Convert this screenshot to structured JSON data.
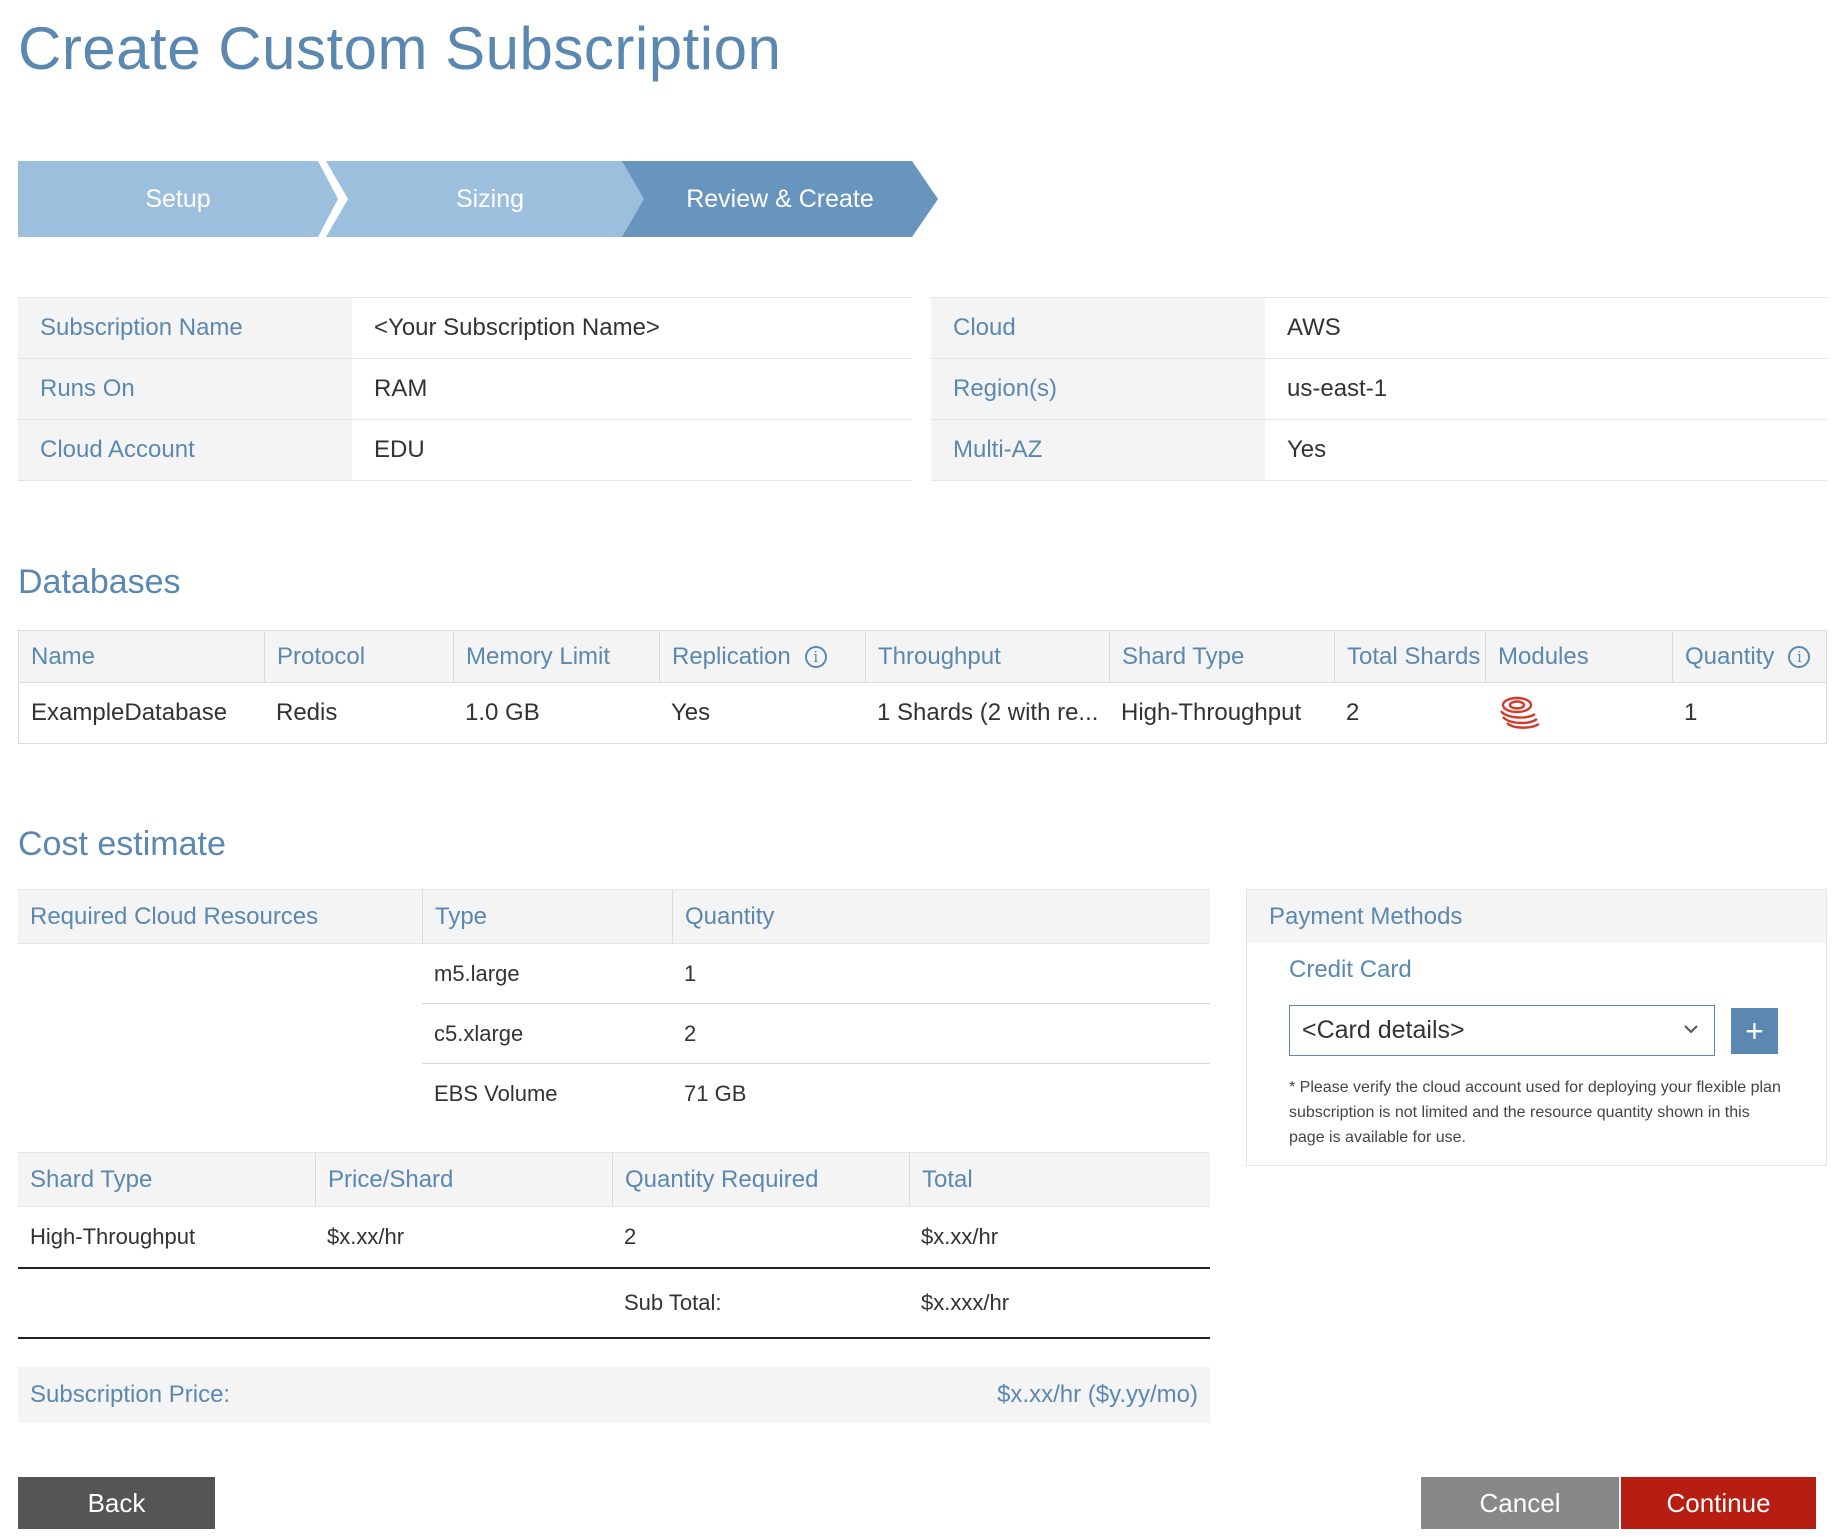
{
  "page": {
    "title": "Create Custom Subscription"
  },
  "wizard": {
    "steps": [
      "Setup",
      "Sizing",
      "Review & Create"
    ],
    "active_step": "Review & Create"
  },
  "summary_left": [
    {
      "label": "Subscription Name",
      "value": "<Your Subscription Name>"
    },
    {
      "label": "Runs On",
      "value": "RAM"
    },
    {
      "label": "Cloud Account",
      "value": "EDU"
    }
  ],
  "summary_right": [
    {
      "label": "Cloud",
      "value": "AWS"
    },
    {
      "label": "Region(s)",
      "value": "us-east-1"
    },
    {
      "label": "Multi-AZ",
      "value": "Yes"
    }
  ],
  "databases": {
    "heading": "Databases",
    "columns": [
      "Name",
      "Protocol",
      "Memory Limit",
      "Replication",
      "Throughput",
      "Shard Type",
      "Total Shards",
      "Modules",
      "Quantity"
    ],
    "rows": [
      {
        "name": "ExampleDatabase",
        "protocol": "Redis",
        "memory_limit": "1.0 GB",
        "replication": "Yes",
        "throughput": "1 Shards (2 with re...",
        "shard_type": "High-Throughput",
        "total_shards": "2",
        "modules": "module-stack-icon",
        "quantity": "1"
      }
    ]
  },
  "cost": {
    "heading": "Cost estimate",
    "resources": {
      "columns": [
        "Required Cloud Resources",
        "Type",
        "Quantity"
      ],
      "rows": [
        {
          "type": "m5.large",
          "quantity": "1"
        },
        {
          "type": "c5.xlarge",
          "quantity": "2"
        },
        {
          "type": "EBS Volume",
          "quantity": "71 GB"
        }
      ]
    },
    "shards": {
      "columns": [
        "Shard Type",
        "Price/Shard",
        "Quantity Required",
        "Total"
      ],
      "rows": [
        {
          "shard_type": "High-Throughput",
          "price": "$x.xx/hr",
          "quantity": "2",
          "total": "$x.xx/hr"
        }
      ],
      "subtotal_label": "Sub Total:",
      "subtotal_value": "$x.xxx/hr"
    },
    "subscription_price_label": "Subscription Price:",
    "subscription_price_value": "$x.xx/hr ($y.yy/mo)"
  },
  "payment": {
    "heading": "Payment Methods",
    "method_label": "Credit Card",
    "selected_card": "<Card details>",
    "add_label": "+",
    "note": "* Please verify the cloud account used for deploying your flexible plan subscription is not limited and the resource quantity shown in this page is available for use."
  },
  "buttons": {
    "back": "Back",
    "cancel": "Cancel",
    "continue": "Continue"
  },
  "colors": {
    "accent": "#5b88b0",
    "step_inactive": "#9dbfde",
    "step_active": "#6795bd",
    "continue": "#b81d12",
    "module_icon": "#d23a2c"
  }
}
